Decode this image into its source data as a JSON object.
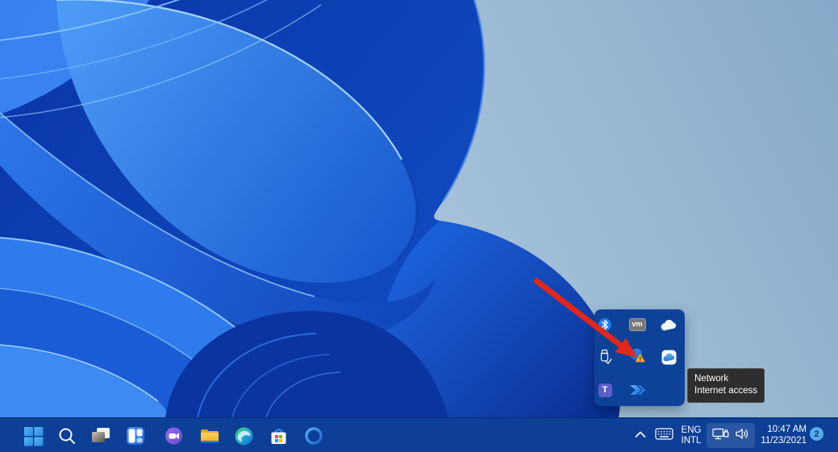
{
  "desktop": {
    "wallpaper_name": "windows-11-bloom",
    "colors": {
      "background_light": "#c6dbeb",
      "background_shade": "#86aac9",
      "petal_dark": "#0a35a8",
      "petal_bright": "#4f9ef8",
      "petal_mid": "#2d77ea"
    }
  },
  "taskbar": {
    "color": "#0c3f95",
    "apps": [
      {
        "name": "start"
      },
      {
        "name": "search"
      },
      {
        "name": "task-view"
      },
      {
        "name": "widgets"
      },
      {
        "name": "chat"
      },
      {
        "name": "file-explorer"
      },
      {
        "name": "edge"
      },
      {
        "name": "store"
      },
      {
        "name": "cortana-ring"
      }
    ],
    "tray": {
      "chevron_icon": "chevron-up",
      "keyboard_icon": "touch-keyboard",
      "language_line1": "ENG",
      "language_line2": "INTL",
      "network_icon": "ethernet-network",
      "volume_icon": "speaker-volume",
      "time": "10:47 AM",
      "date": "11/23/2021",
      "notification_count": "2",
      "badge_color": "#55aaea"
    }
  },
  "overflow_popup": {
    "background": "#0d4298",
    "icons": [
      {
        "name": "bluetooth"
      },
      {
        "name": "vmware",
        "label": "vm"
      },
      {
        "name": "onedrive-cloud"
      },
      {
        "name": "usb-safely-remove"
      },
      {
        "name": "network-warning"
      },
      {
        "name": "cloud-app"
      },
      {
        "name": "teams",
        "label": "T"
      },
      {
        "name": "power-automate"
      }
    ]
  },
  "tooltip": {
    "line1": "Network",
    "line2": "Internet access",
    "background": "#2e2e2e"
  },
  "annotation_arrow": {
    "color": "#e3271b"
  }
}
